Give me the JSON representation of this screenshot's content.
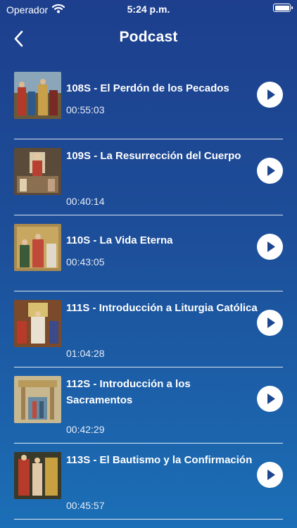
{
  "status_bar": {
    "carrier": "Operador",
    "time": "5:24 p.m."
  },
  "nav": {
    "title": "Podcast",
    "back_icon": "chevron-left-icon"
  },
  "episodes": [
    {
      "title": "108S - El Perdón de los Pecados",
      "duration": "00:55:03"
    },
    {
      "title": "109S - La Resurrección del Cuerpo",
      "duration": "00:40:14"
    },
    {
      "title": "110S - La Vida Eterna",
      "duration": "00:43:05"
    },
    {
      "title": "111S - Introducción a Liturgia Católica",
      "duration": "01:04:28"
    },
    {
      "title": "112S - Introducción a los Sacramentos",
      "duration": "00:42:29"
    },
    {
      "title": "113S - El Bautismo y la Confirmación",
      "duration": "00:45:57"
    }
  ],
  "colors": {
    "background_top": "#1d3f8d",
    "background_bottom": "#1b6fb6",
    "play_icon": "#1d4690"
  }
}
